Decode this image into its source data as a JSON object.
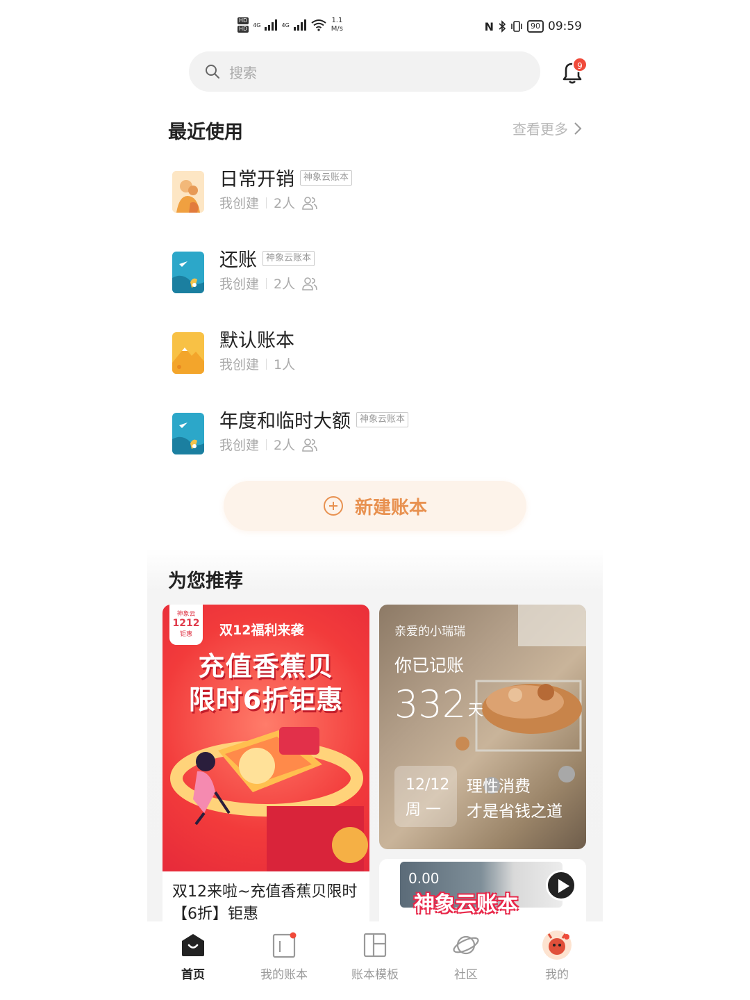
{
  "status_bar": {
    "hd1": "HD",
    "hd2": "HD",
    "net1": "4G",
    "net2": "4G",
    "speed_value": "1.1",
    "speed_unit": "M/s",
    "nfc": "N",
    "battery": "90",
    "time": "09:59"
  },
  "search": {
    "placeholder": "搜索"
  },
  "notifications": {
    "count": "9"
  },
  "recent": {
    "title": "最近使用",
    "more_label": "查看更多",
    "books": [
      {
        "name": "日常开销",
        "tag": "神象云账本",
        "creator": "我创建",
        "members": "2人"
      },
      {
        "name": "还账",
        "tag": "神象云账本",
        "creator": "我创建",
        "members": "2人"
      },
      {
        "name": "默认账本",
        "tag": "",
        "creator": "我创建",
        "members": "1人"
      },
      {
        "name": "年度和临时大额",
        "tag": "神象云账本",
        "creator": "我创建",
        "members": "2人"
      }
    ],
    "new_book_label": "新建账本"
  },
  "recommend": {
    "title": "为您推荐",
    "promo": {
      "stamp_brand": "神象云",
      "stamp_number": "1212",
      "stamp_sub": "钜惠",
      "top_line": "双12福利来袭",
      "headline1": "充值香蕉贝",
      "headline2": "限时6折钜惠",
      "caption": "双12来啦~充值香蕉贝限时【6折】钜惠"
    },
    "stats": {
      "greeting": "亲爱的小瑞瑞",
      "line": "你已记账",
      "days": "332",
      "unit": "天",
      "date": "12/12",
      "weekday": "周 一",
      "quote1": "理性消费",
      "quote2": "才是省钱之道"
    },
    "video": {
      "amount": "0.00",
      "title": "神象云账本"
    }
  },
  "tabs": [
    {
      "label": "首页"
    },
    {
      "label": "我的账本"
    },
    {
      "label": "账本模板"
    },
    {
      "label": "社区"
    },
    {
      "label": "我的"
    }
  ]
}
